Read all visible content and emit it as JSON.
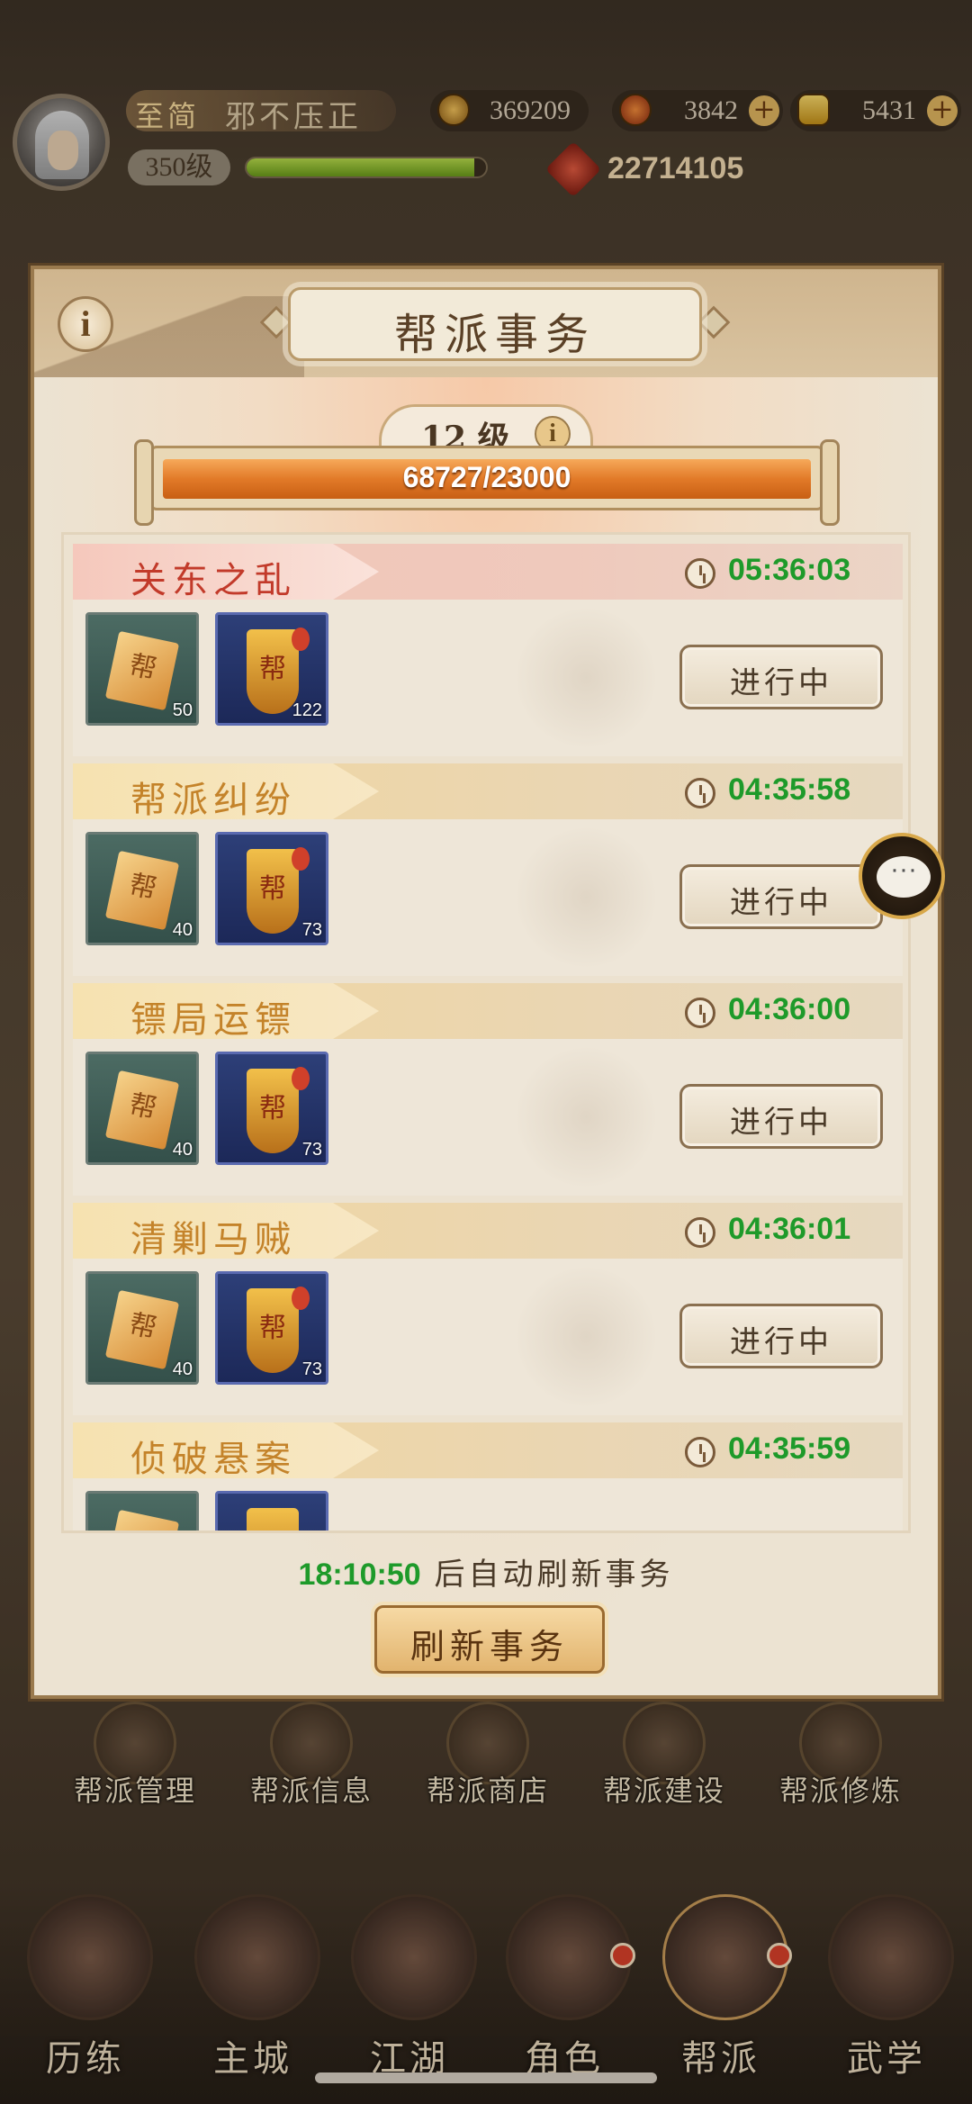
{
  "player": {
    "vip_label": "至简",
    "name": "邪不压正",
    "level": "350级",
    "exp_fraction": 0.95,
    "power": "22714105"
  },
  "resources": [
    {
      "icon": "copper-coin-icon",
      "value": "369209"
    },
    {
      "icon": "fire-stone-icon",
      "value": "3842"
    },
    {
      "icon": "gold-ingot-icon",
      "value": "5431"
    }
  ],
  "panel": {
    "title": "帮派事务",
    "level_label": "12 级",
    "progress_text": "68727/23000",
    "progress_fraction": 1.0,
    "refresh_time": "18:10:50",
    "refresh_suffix": "后自动刷新事务",
    "refresh_button": "刷新事务"
  },
  "tasks": [
    {
      "name": "关东之乱",
      "time": "05:36:03",
      "style": "red",
      "item1_count": "50",
      "item2_count": "122",
      "status": "进行中"
    },
    {
      "name": "帮派纠纷",
      "time": "04:35:58",
      "style": "gold",
      "item1_count": "40",
      "item2_count": "73",
      "status": "进行中"
    },
    {
      "name": "镖局运镖",
      "time": "04:36:00",
      "style": "gold",
      "item1_count": "40",
      "item2_count": "73",
      "status": "进行中"
    },
    {
      "name": "清剿马贼",
      "time": "04:36:01",
      "style": "gold",
      "item1_count": "40",
      "item2_count": "73",
      "status": "进行中"
    },
    {
      "name": "侦破悬案",
      "time": "04:35:59",
      "style": "gold",
      "item1_count": "",
      "item2_count": "",
      "status": ""
    }
  ],
  "item_glyph": "帮",
  "chat_glyph": "···",
  "guild_menu": [
    "帮派管理",
    "帮派信息",
    "帮派商店",
    "帮派建设",
    "帮派修炼"
  ],
  "bottom_nav": [
    "历练",
    "主城",
    "江湖",
    "角色",
    "帮派",
    "武学"
  ],
  "info_glyph": "i",
  "plus_glyph": "+"
}
